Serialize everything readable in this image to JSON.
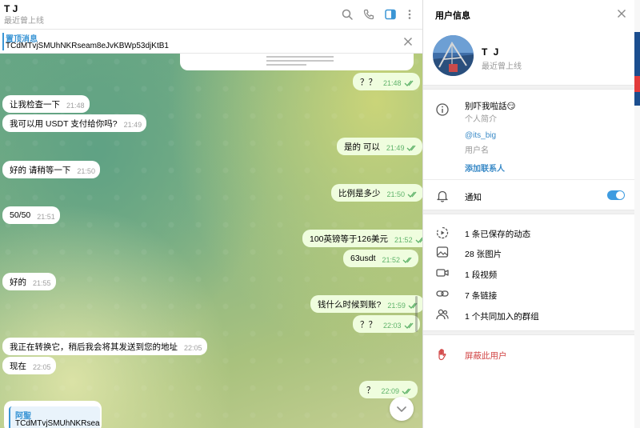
{
  "chat": {
    "title": "T J",
    "status": "最近曾上线",
    "pinned": {
      "title": "置顶消息",
      "text": "TCdMTvjSMUhNKRseam8eJvKBWp53djKtB1"
    },
    "messages": [
      {
        "side": "out",
        "text": "？？",
        "time": "21:48",
        "ticks": true
      },
      {
        "side": "in",
        "text": "让我检查一下",
        "time": "21:48"
      },
      {
        "side": "in",
        "text": "我可以用 USDT 支付给你吗?",
        "time": "21:49"
      },
      {
        "side": "out",
        "text": "是的 可以",
        "time": "21:49",
        "ticks": true
      },
      {
        "side": "in",
        "text": "好的 请稍等一下",
        "time": "21:50"
      },
      {
        "side": "out",
        "text": "比例是多少",
        "time": "21:50",
        "ticks": true
      },
      {
        "side": "in",
        "text": "50/50",
        "time": "21:51"
      },
      {
        "side": "out",
        "text": "100英镑等于126美元",
        "time": "21:52",
        "ticks": true
      },
      {
        "side": "out",
        "text": "63usdt",
        "time": "21:52",
        "ticks": true
      },
      {
        "side": "in",
        "text": "好的",
        "time": "21:55"
      },
      {
        "side": "out",
        "text": "钱什么时候到账?",
        "time": "21:59",
        "ticks": true
      },
      {
        "side": "out",
        "text": "？？",
        "time": "22:03",
        "ticks": true
      },
      {
        "side": "in",
        "text": "我正在转换它，稍后我会将其发送到您的地址",
        "time": "22:05"
      },
      {
        "side": "in",
        "text": "现在",
        "time": "22:05"
      },
      {
        "side": "out",
        "text": "？",
        "time": "22:09",
        "ticks": true
      }
    ],
    "reply": {
      "name": "阿聖",
      "text": "TCdMTvjSMUhNKRsea..."
    }
  },
  "info": {
    "title": "用户信息",
    "name": "T J",
    "status": "最近曾上线",
    "bio": "别吓我啦話😏",
    "bio_label": "个人简介",
    "username": "@its_big",
    "username_label": "用户名",
    "add_contact": "添加联系人",
    "notifications": "通知",
    "notifications_on": true,
    "media": [
      {
        "icon": "stories-icon",
        "label": "1 条已保存的动态"
      },
      {
        "icon": "photo-icon",
        "label": "28 张图片"
      },
      {
        "icon": "video-icon",
        "label": "1 段视频"
      },
      {
        "icon": "link-icon",
        "label": "7 条链接"
      },
      {
        "icon": "groups-icon",
        "label": "1 个共同加入的群组"
      }
    ],
    "block": "屏蔽此用户"
  },
  "colors": {
    "accent": "#3a95d5",
    "outgoing_bubble": "#effdde",
    "danger": "#d24545"
  }
}
